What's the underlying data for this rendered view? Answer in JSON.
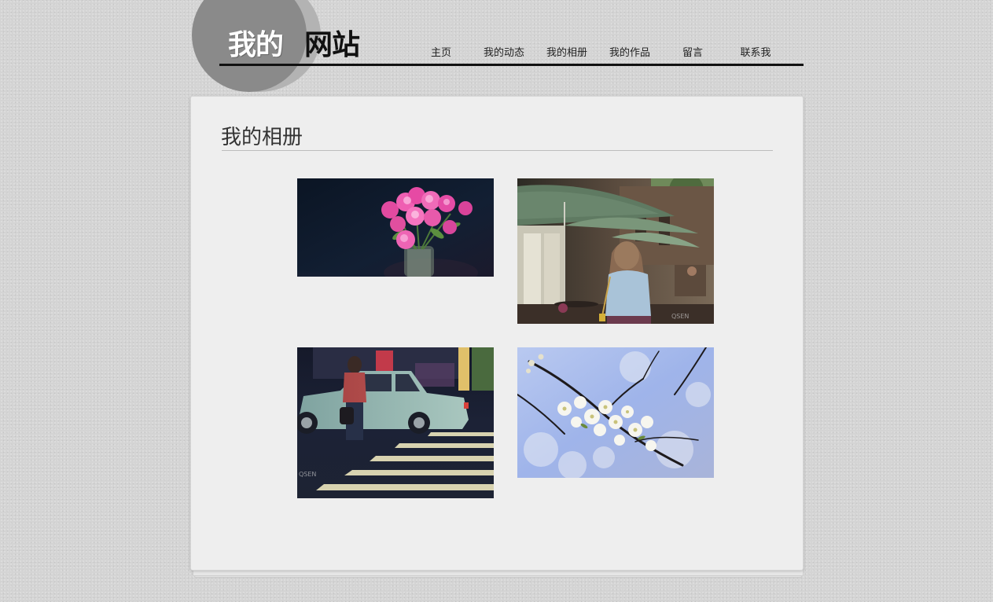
{
  "site": {
    "logo_part1": "我的",
    "logo_part2": "网站"
  },
  "nav": {
    "items": [
      "主页",
      "我的动态",
      "我的相册",
      "我的作品",
      "留言",
      "联系我"
    ]
  },
  "gallery": {
    "title": "我的相册",
    "photos": [
      {
        "subject": "pink carnations in a glass vase"
      },
      {
        "subject": "woman walking past cafe umbrellas",
        "watermark": "QSEN"
      },
      {
        "subject": "woman standing by a green car at a crosswalk",
        "watermark": "QSEN"
      },
      {
        "subject": "white blossoms on a branch against blue sky"
      }
    ]
  },
  "colors": {
    "background": "#d4d4d4",
    "panel": "#eeeeee",
    "logo_circle": "#8a8a8a",
    "header_rule": "#111111",
    "text": "#333333"
  }
}
